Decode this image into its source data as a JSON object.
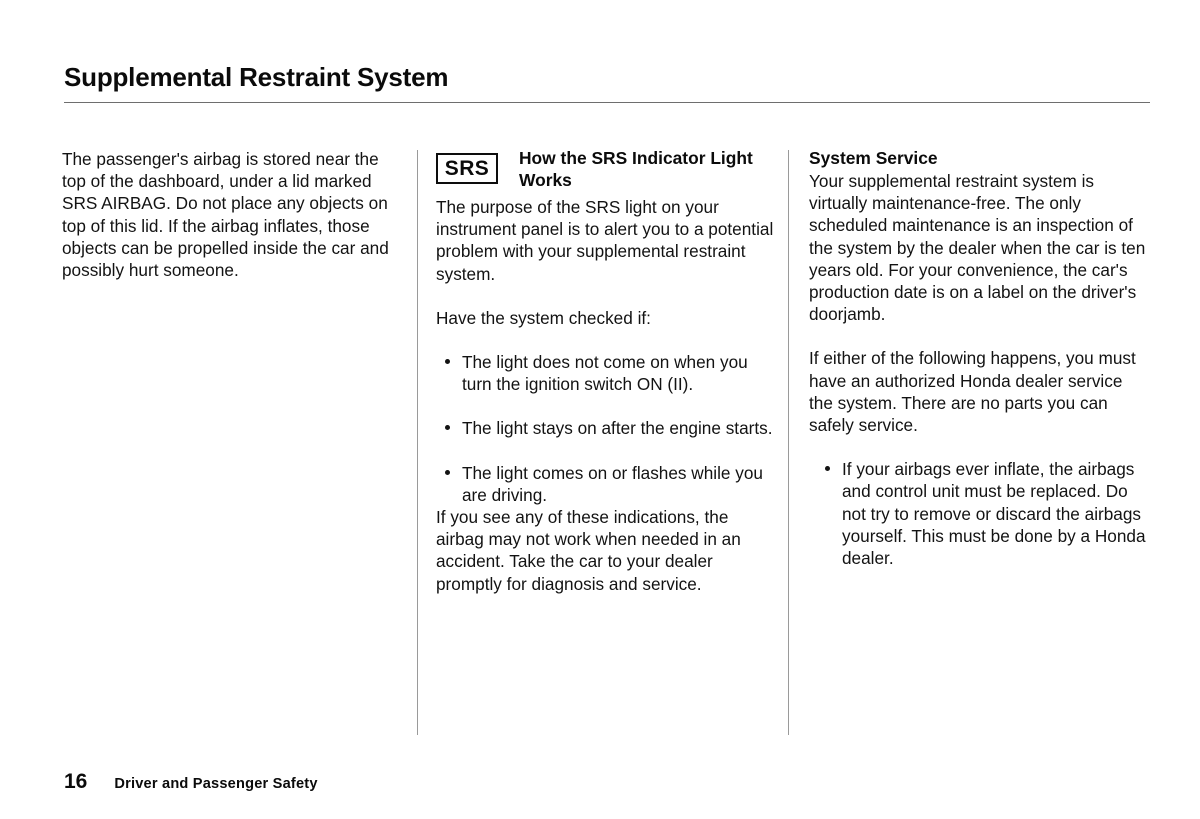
{
  "page": {
    "title": "Supplemental Restraint System"
  },
  "columns": {
    "left": {
      "paragraphs": [
        "The passenger's airbag is stored near the top of the dashboard, under a lid marked SRS AIRBAG. Do not place any objects on top of this lid. If the airbag inflates, those objects can be propelled inside the car and possibly hurt someone."
      ]
    },
    "middle": {
      "badge_label": "SRS",
      "heading": "How the SRS Indicator Light Works",
      "intro_paragraph": "The purpose of the SRS light on your instrument panel is to alert you to a potential problem with your supplemental restraint system.",
      "list_lead_in": "Have the system checked if:",
      "bullets": [
        "The light does not come on when you turn the ignition switch ON (II).",
        "The light stays on after the engine starts.",
        "The light comes on or flashes while you are driving."
      ],
      "closing_paragraph": "If you see any of these indications, the airbag may not work when needed in an accident. Take the car to your dealer promptly for diagnosis and service."
    },
    "right": {
      "heading": "System Service",
      "paragraphs": [
        "Your supplemental restraint system is virtually maintenance-free. The only scheduled maintenance is an inspection of the system by the dealer when the car is ten years old. For your convenience, the car's production date is on a label on the driver's doorjamb.",
        "If either of the following happens, you must have an authorized Honda dealer service the system. There are no parts you can safely service."
      ],
      "bullets": [
        "If your airbags ever inflate, the airbags and control unit must be replaced. Do not try to remove or discard the airbags yourself. This must be done by a Honda dealer."
      ]
    }
  },
  "footer": {
    "page_number": "16",
    "section_name": "Driver and Passenger Safety"
  }
}
